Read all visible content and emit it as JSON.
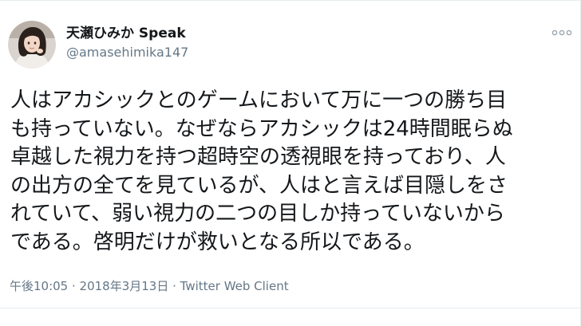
{
  "user": {
    "display_name": "天瀬ひみか Speak",
    "handle": "@amasehimika147"
  },
  "tweet": {
    "lines": [
      "人はアカシックとのゲームにおいて万に一つの勝ち目",
      "も持っていない。なぜならアカシックは24時間眠らぬ",
      "卓越した視力を持つ超時空の透視眼を持っており、人",
      "の出方の全てを見ているが、人はと言えば目隠しをさ",
      "れていて、弱い視力の二つの目しか持っていないから",
      "である。啓明だけが救いとなる所以である。"
    ]
  },
  "meta": {
    "timestamp": "午後10:05 · 2018年3月13日",
    "separator": " · ",
    "source": "Twitter Web Client"
  },
  "icons": {
    "more": "more-dots-icon",
    "avatar": "avatar"
  },
  "colors": {
    "text": "#14171a",
    "secondary": "#657786",
    "border": "#e6ecf0"
  }
}
